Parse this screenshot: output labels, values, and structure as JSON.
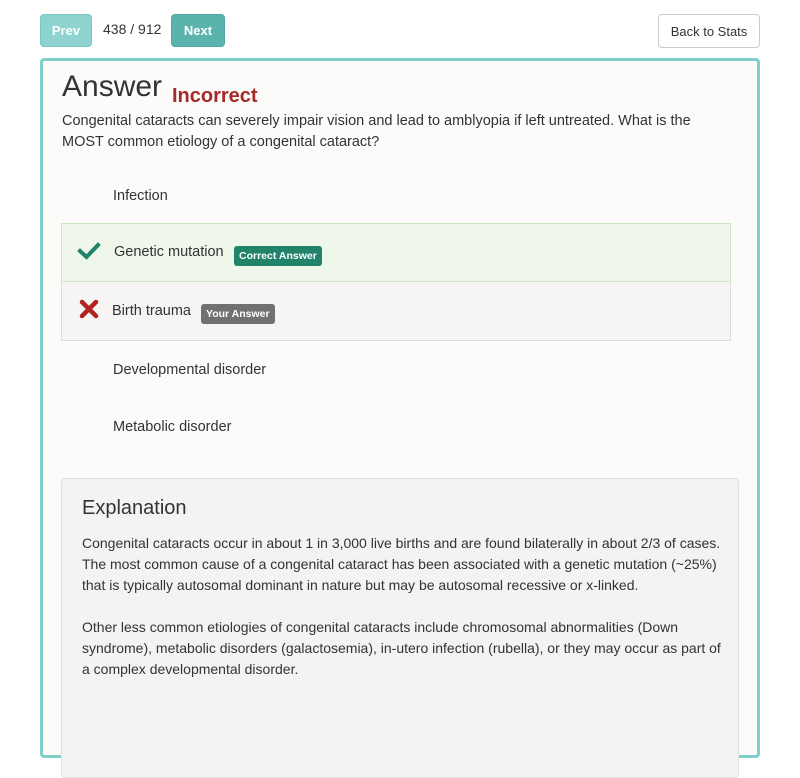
{
  "nav": {
    "prev_label": "Prev",
    "counter": "438 / 912",
    "next_label": "Next",
    "back_label": "Back to Stats"
  },
  "answer": {
    "heading": "Answer",
    "verdict": "Incorrect",
    "question": "Congenital cataracts can severely impair vision and lead to amblyopia if left untreated. What is the MOST common etiology of a congenital cataract?"
  },
  "options": [
    {
      "label": "Infection",
      "state": "none"
    },
    {
      "label": "Genetic mutation",
      "state": "correct",
      "badge": "Correct Answer"
    },
    {
      "label": "Birth trauma",
      "state": "wrong",
      "badge": "Your Answer"
    },
    {
      "label": "Developmental disorder",
      "state": "none"
    },
    {
      "label": "Metabolic disorder",
      "state": "none"
    }
  ],
  "explanation": {
    "title": "Explanation",
    "paragraphs": [
      "Congenital cataracts occur in about 1 in 3,000 live births and are found bilaterally in about 2/3 of cases. The most common cause of a congenital cataract has been associated with a genetic mutation (~25%) that is typically autosomal dominant in nature but may be autosomal recessive or x-linked.",
      "Other less common etiologies of congenital cataracts include chromosomal abnormalities (Down syndrome), metabolic disorders (galactosemia), in-utero infection (rubella), or they may occur as part of a complex developmental disorder."
    ]
  },
  "colors": {
    "teal_border": "#7fcfca",
    "verdict_red": "#a52a2a",
    "check_green": "#21836a",
    "x_red": "#b22222"
  },
  "icons": {
    "correct": "check-icon",
    "wrong": "x-icon"
  }
}
